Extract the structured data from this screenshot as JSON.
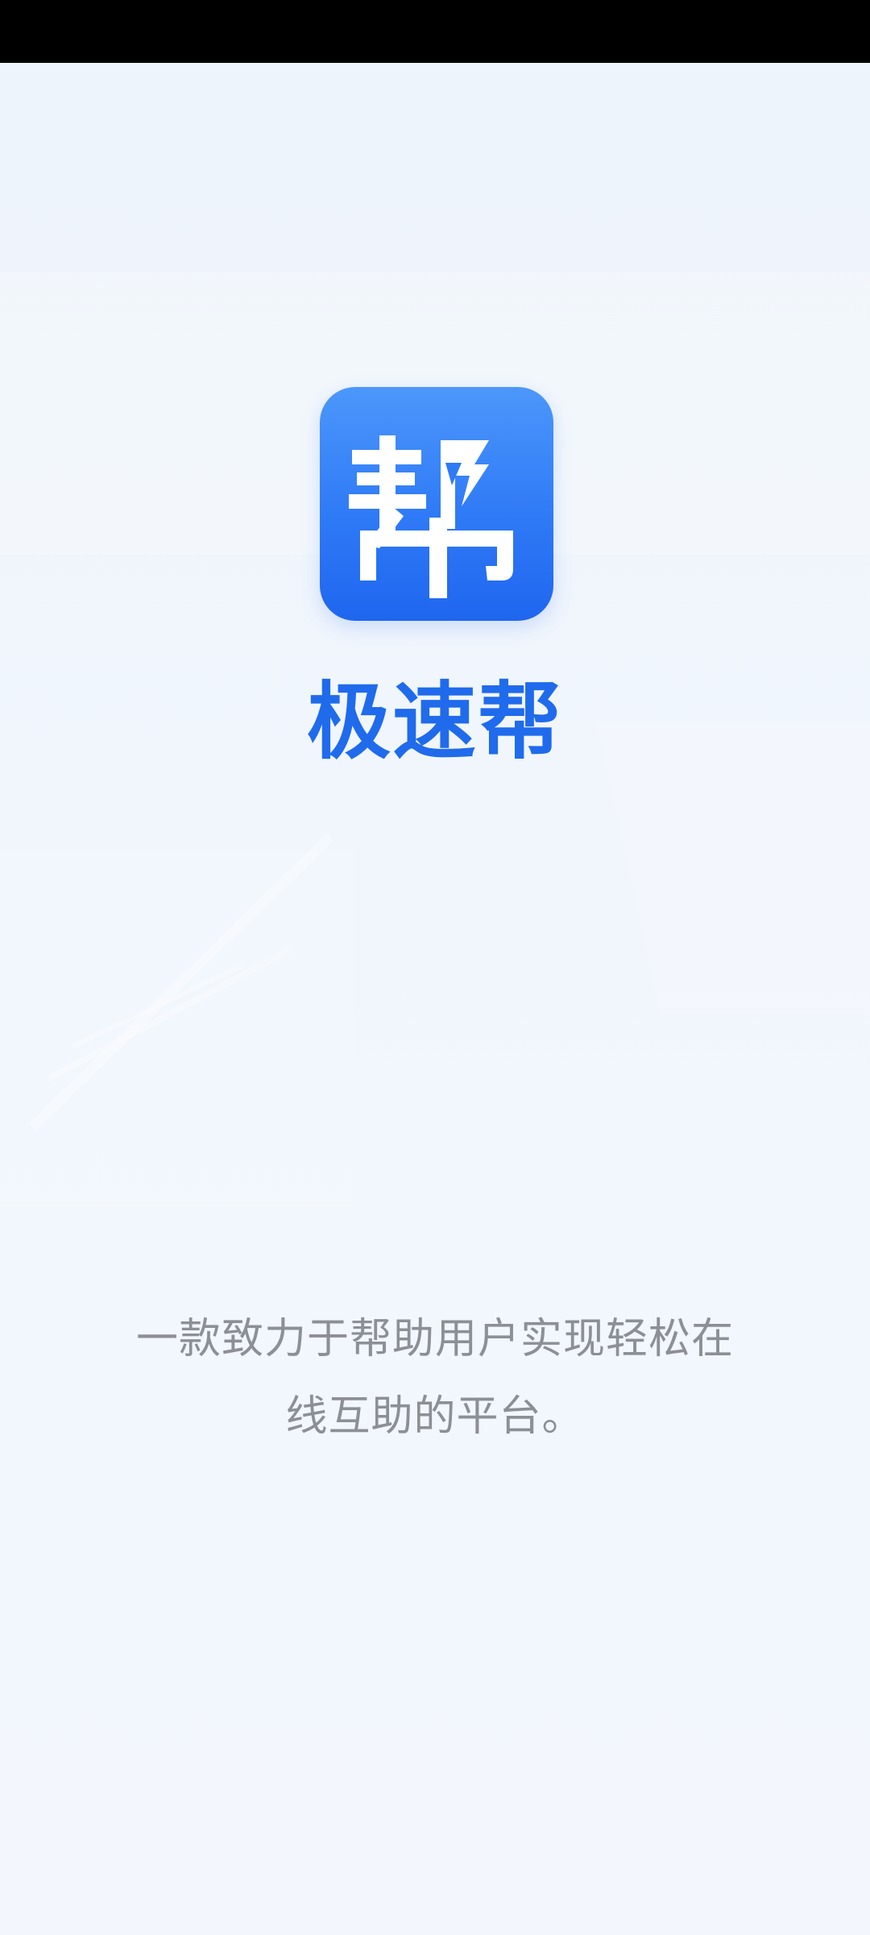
{
  "splash": {
    "app_name": "极速帮",
    "logo_glyph": "帮",
    "tagline": "一款致力于帮助用户实现轻松在线互助的平台。"
  },
  "icons": {
    "app_logo": "bang-character-lightning-logo"
  },
  "colors": {
    "brand_blue": "#1f6bec",
    "icon_gradient_top": "#4c97fb",
    "icon_gradient_bottom": "#1f66ef",
    "tagline_gray": "#8c9096",
    "background": "#f1f6fc",
    "status_bar": "#000000"
  }
}
